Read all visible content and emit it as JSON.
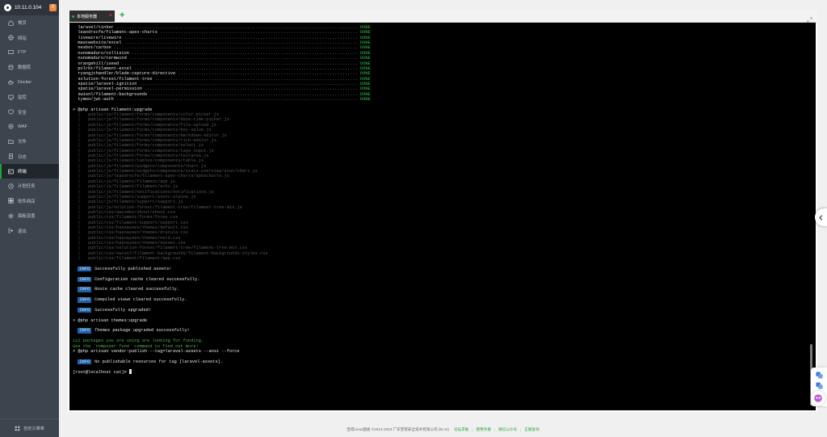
{
  "sidebar": {
    "ip": "10.11.0.104",
    "badge": "0",
    "items": [
      {
        "label": "首页",
        "icon": "home-icon"
      },
      {
        "label": "网站",
        "icon": "globe-icon"
      },
      {
        "label": "FTP",
        "icon": "ftp-icon"
      },
      {
        "label": "数据库",
        "icon": "database-icon"
      },
      {
        "label": "Docker",
        "icon": "docker-icon"
      },
      {
        "label": "监控",
        "icon": "monitor-icon"
      },
      {
        "label": "安全",
        "icon": "shield-icon"
      },
      {
        "label": "WAF",
        "icon": "waf-icon"
      },
      {
        "label": "文件",
        "icon": "folder-icon"
      },
      {
        "label": "日志",
        "icon": "log-icon"
      },
      {
        "label": "终端",
        "icon": "terminal-icon",
        "active": true
      },
      {
        "label": "计划任务",
        "icon": "clock-icon"
      },
      {
        "label": "软件商店",
        "icon": "store-icon"
      },
      {
        "label": "面板设置",
        "icon": "gear-icon"
      },
      {
        "label": "退出",
        "icon": "logout-icon"
      }
    ],
    "footer_label": "自定义菜单"
  },
  "tabbar": {
    "tab_label": "本地服务器",
    "add_label": "+"
  },
  "terminal": {
    "packages": [
      "laravel/tinker",
      "leandrocfe/filament-apex-charts",
      "livewire/livewire",
      "maatwebsite/excel",
      "nesbot/carbon",
      "nunomaduro/collision",
      "nunomaduro/termwind",
      "orangehill/iseed",
      "pxlrbt/filament-excel",
      "ryangjchandler/blade-capture-directive",
      "solution-forest/filament-tree",
      "spatie/laravel-ignition",
      "spatie/laravel-permission",
      "swisnl/filament-backgrounds",
      "tymon/jwt-auth"
    ],
    "done_label": "DONE",
    "cmd1": "> @php artisan filament:upgrade",
    "asset_paths": [
      "  public/js/filament/forms/components/color-picker.js",
      "  public/js/filament/forms/components/date-time-picker.js",
      "  public/js/filament/forms/components/file-upload.js",
      "  public/js/filament/forms/components/key-value.js",
      "  public/js/filament/forms/components/markdown-editor.js",
      "  public/js/filament/forms/components/rich-editor.js",
      "  public/js/filament/forms/components/select.js",
      "  public/js/filament/forms/components/tags-input.js",
      "  public/js/filament/forms/components/textarea.js",
      "  public/js/filament/tables/components/table.js",
      "  public/js/filament/widgets/components/chart.js",
      "  public/js/filament/widgets/components/stats-overview/stat/chart.js",
      "  public/js/leandrocfe/filament-apex-charts/apexcharts.js",
      "  public/js/filament/filament/app.js",
      "  public/js/filament/filament/echo.js",
      "  public/js/filament/notifications/notifications.js",
      "  public/js/filament/support/async-alpine.js",
      "  public/js/filament/support/support.js",
      "  public/js/solution-forest/filament-tree/filament-tree-min.js",
      "  public/css/awcodes/shout/shout.css",
      "  public/css/filament/forms/forms.css",
      "  public/css/filament/support/support.css",
      "  public/css/hasnayeen/themes/default.css",
      "  public/css/hasnayeen/themes/dracula.css",
      "  public/css/hasnayeen/themes/nord.css",
      "  public/css/hasnayeen/themes/sunset.css",
      "  public/css/solution-forest/filament-tree/filament-tree-min.css",
      "  public/css/swisnl/filament-backgrounds/filament-backgrounds-styles.css",
      "  public/css/filament/filament/app.css"
    ],
    "info_tag": "INFO",
    "info1": "Successfully published assets!",
    "info2": "Configuration cache cleared successfully.",
    "info3": "Route cache cleared successfully.",
    "info4": "Compiled views cleared successfully.",
    "info5": "Successfully upgraded!",
    "cmd2": "> @php artisan themes:upgrade",
    "info6": "Themes package upgraded successfully!",
    "funding1": "112 packages you are using are looking for funding.",
    "funding2": "Use the `composer fund` command to find out more!",
    "cmd3": "> @php artisan vendor:publish --tag=laravel-assets --ansi --force",
    "info7": "No publishable resources for tag [laravel-assets].",
    "prompt": "[root@localhost cat]# "
  },
  "footer": {
    "copyright": "宝塔Linux面板 ©2014-2023 广东堡塔安全技术有限公司 (bt.cn)",
    "links": [
      "论坛求助",
      "使用手册",
      "微信公众号",
      "正版查询"
    ]
  }
}
